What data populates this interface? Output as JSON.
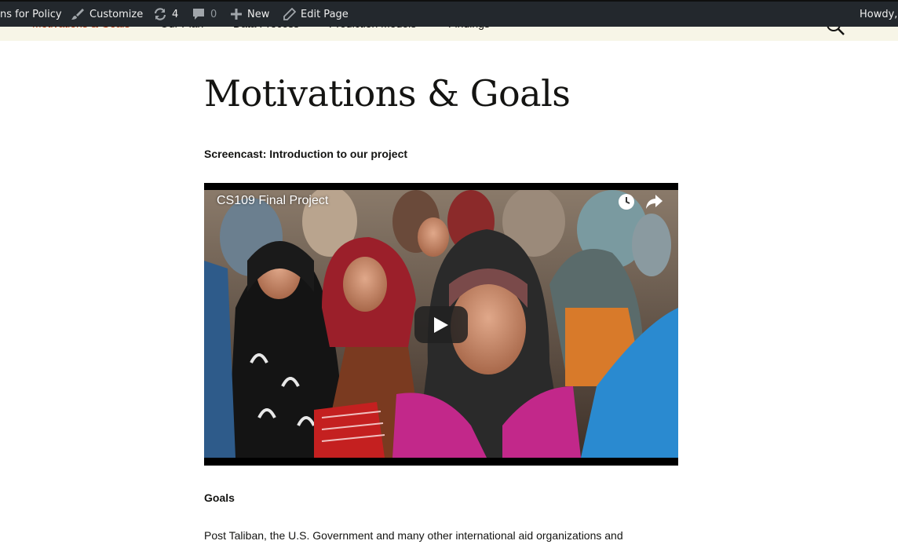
{
  "admin_bar": {
    "site_name": "ns for Policy",
    "customize_label": "Customize",
    "updates_count": "4",
    "comments_count": "0",
    "new_label": "New",
    "edit_label": "Edit Page",
    "howdy_label": "Howdy,"
  },
  "nav": {
    "items": [
      {
        "label": "Motivations & Goals",
        "active": true
      },
      {
        "label": "Our Plan"
      },
      {
        "label": "Data Process"
      },
      {
        "label": "Prediction Models"
      },
      {
        "label": "Findings"
      }
    ],
    "search_icon": "search-icon"
  },
  "page": {
    "title": "Motivations & Goals",
    "screencast_heading": "Screencast: Introduction to our project",
    "video": {
      "title": "CS109 Final Project",
      "icons": [
        "watch-later-icon",
        "share-icon",
        "play-icon"
      ]
    },
    "goals_heading": "Goals",
    "paragraph": "Post Taliban, the U.S. Government and many other international aid organizations and"
  },
  "colors": {
    "admin_bar_bg": "#23282d",
    "nav_bg": "#f7f5e7",
    "active_nav": "#bc360a",
    "text": "#141412"
  }
}
